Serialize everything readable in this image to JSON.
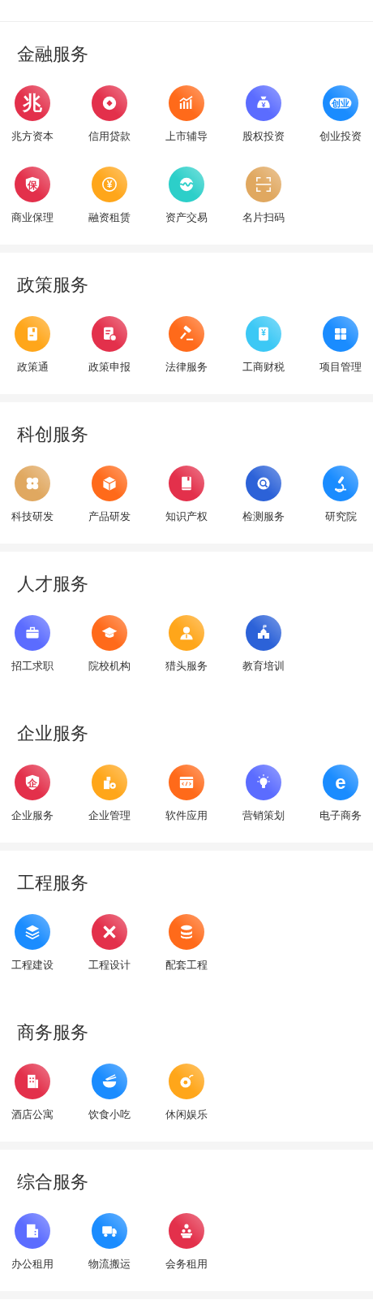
{
  "sections": [
    {
      "title": "金融服务",
      "divider": true,
      "items": [
        {
          "label": "兆方资本",
          "kind": "char",
          "glyph": "兆",
          "color": "#e3304b"
        },
        {
          "label": "信用贷款",
          "kind": "coin",
          "color": "#e3304b"
        },
        {
          "label": "上市辅导",
          "kind": "chart",
          "color": "#ff6a1a"
        },
        {
          "label": "股权投资",
          "kind": "moneybag",
          "glyph": "¥",
          "color": "#5b6cff"
        },
        {
          "label": "创业投资",
          "kind": "pill",
          "glyph": "创业",
          "color": "#1a8cff"
        },
        {
          "label": "商业保理",
          "kind": "shield",
          "glyph": "保",
          "color": "#e3304b"
        },
        {
          "label": "融资租赁",
          "kind": "ring",
          "glyph": "¥",
          "color": "#ffa61a"
        },
        {
          "label": "资产交易",
          "kind": "wave",
          "color": "#2ccfc9"
        },
        {
          "label": "名片扫码",
          "kind": "scan",
          "color": "#e0a860"
        }
      ]
    },
    {
      "title": "政策服务",
      "divider": true,
      "items": [
        {
          "label": "政策通",
          "kind": "doc",
          "color": "#ffa61a"
        },
        {
          "label": "政策申报",
          "kind": "docplus",
          "color": "#e3304b"
        },
        {
          "label": "法律服务",
          "kind": "gavel",
          "color": "#ff6a1a"
        },
        {
          "label": "工商财税",
          "kind": "ledger",
          "glyph": "¥",
          "color": "#3cc8f5"
        },
        {
          "label": "项目管理",
          "kind": "grid",
          "color": "#1a8cff"
        }
      ]
    },
    {
      "title": "科创服务",
      "divider": true,
      "items": [
        {
          "label": "科技研发",
          "kind": "flower",
          "color": "#e0a860"
        },
        {
          "label": "产品研发",
          "kind": "cube",
          "color": "#ff6a1a"
        },
        {
          "label": "知识产权",
          "kind": "book",
          "color": "#e3304b"
        },
        {
          "label": "检测服务",
          "kind": "search",
          "color": "#2c62d8"
        },
        {
          "label": "研究院",
          "kind": "microscope",
          "color": "#1a8cff"
        }
      ]
    },
    {
      "title": "人才服务",
      "divider": false,
      "items": [
        {
          "label": "招工求职",
          "kind": "briefcase",
          "color": "#5b6cff"
        },
        {
          "label": "院校机构",
          "kind": "cap",
          "color": "#ff6a1a"
        },
        {
          "label": "猎头服务",
          "kind": "person",
          "color": "#ffa61a"
        },
        {
          "label": "教育培训",
          "kind": "school",
          "color": "#2c62d8"
        }
      ]
    },
    {
      "title": "企业服务",
      "divider": true,
      "items": [
        {
          "label": "企业服务",
          "kind": "shield",
          "glyph": "企",
          "color": "#e3304b"
        },
        {
          "label": "企业管理",
          "kind": "factory",
          "color": "#ffa61a"
        },
        {
          "label": "软件应用",
          "kind": "code",
          "color": "#ff6a1a"
        },
        {
          "label": "营销策划",
          "kind": "bulb",
          "color": "#5b6cff"
        },
        {
          "label": "电子商务",
          "kind": "char",
          "glyph": "e",
          "color": "#1a8cff"
        }
      ]
    },
    {
      "title": "工程服务",
      "divider": false,
      "items": [
        {
          "label": "工程建设",
          "kind": "layers",
          "color": "#1a8cff"
        },
        {
          "label": "工程设计",
          "kind": "tools",
          "color": "#e3304b"
        },
        {
          "label": "配套工程",
          "kind": "database",
          "color": "#ff6a1a"
        }
      ]
    },
    {
      "title": "商务服务",
      "divider": true,
      "items": [
        {
          "label": "酒店公寓",
          "kind": "building",
          "color": "#e3304b"
        },
        {
          "label": "饮食小吃",
          "kind": "bowl",
          "color": "#1a8cff"
        },
        {
          "label": "休闲娱乐",
          "kind": "cup",
          "color": "#ffa61a"
        }
      ]
    },
    {
      "title": "综合服务",
      "divider": true,
      "items": [
        {
          "label": "办公租用",
          "kind": "office",
          "color": "#5b6cff"
        },
        {
          "label": "物流搬运",
          "kind": "truck",
          "color": "#1a8cff"
        },
        {
          "label": "会务租用",
          "kind": "people",
          "color": "#e3304b"
        }
      ]
    }
  ]
}
